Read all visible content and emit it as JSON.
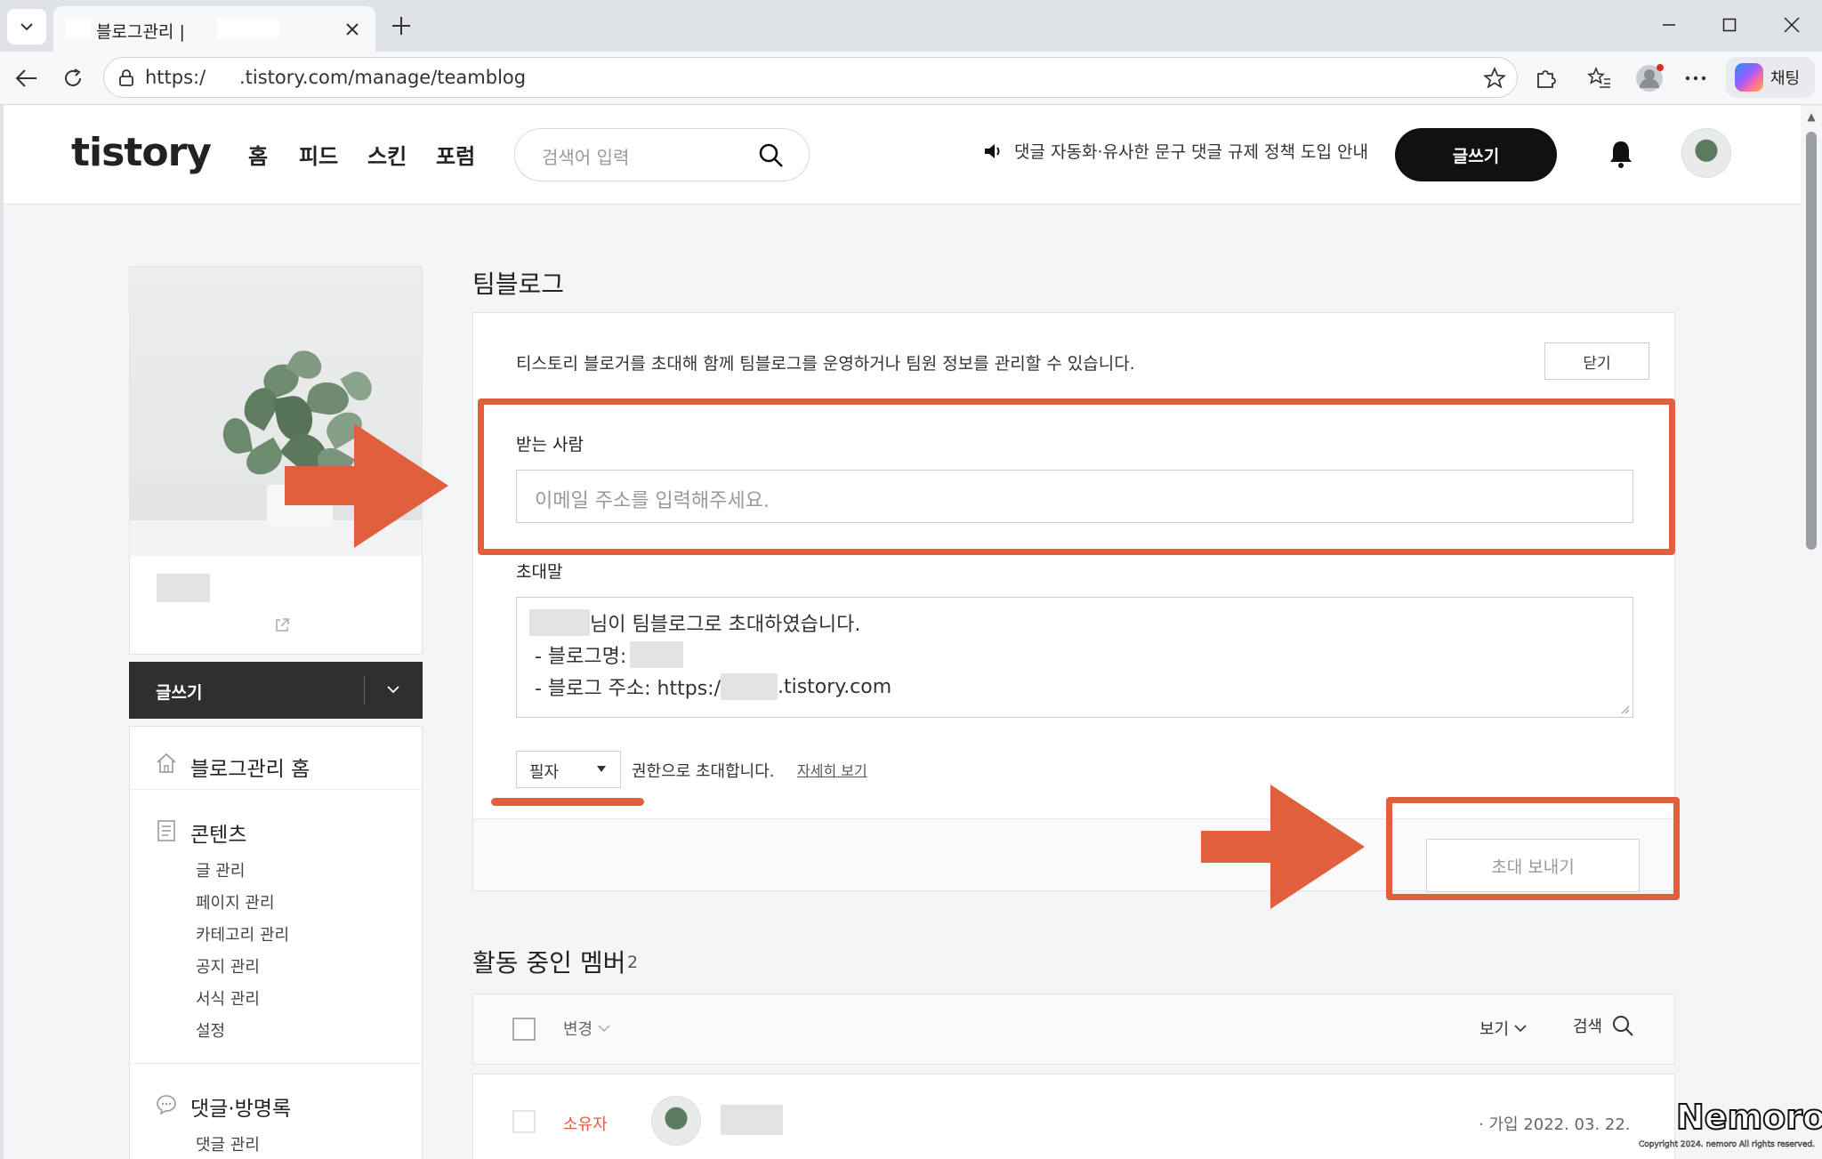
{
  "browser": {
    "tab_title": "블로그관리 |",
    "url_prefix": "https:/",
    "url_rest": ".tistory.com/manage/teamblog",
    "copilot_label": "채팅"
  },
  "header": {
    "logo": "tistory",
    "nav": [
      "홈",
      "피드",
      "스킨",
      "포럼"
    ],
    "search_placeholder": "검색어 입력",
    "notice": "댓글 자동화·유사한 문구 댓글 규제 정책 도입 안내",
    "write_label": "글쓰기"
  },
  "sidebar": {
    "write_label": "글쓰기",
    "home_label": "블로그관리 홈",
    "contents_title": "콘텐츠",
    "contents_items": [
      "글 관리",
      "페이지 관리",
      "카테고리 관리",
      "공지 관리",
      "서식 관리",
      "설정"
    ],
    "comments_title": "댓글·방명록",
    "comments_items": [
      "댓글 관리"
    ]
  },
  "main": {
    "title": "팀블로그",
    "intro": "티스토리 블로거를 초대해 함께 팀블로그를 운영하거나 팀원 정보를 관리할 수 있습니다.",
    "close_label": "닫기",
    "recipient_label": "받는 사람",
    "email_placeholder": "이메일 주소를 입력해주세요.",
    "message_label": "초대말",
    "message_line1": "님이 팀블로그로 초대하였습니다.",
    "message_line2": "- 블로그명:",
    "message_line3_prefix": "- 블로그 주소: https:/",
    "message_line3_suffix": ".tistory.com",
    "role_value": "필자",
    "role_suffix": "권한으로 초대합니다.",
    "details_link": "자세히 보기",
    "send_label": "초대 보내기"
  },
  "members": {
    "title": "활동 중인 멤버",
    "count": "2",
    "change_label": "변경",
    "view_label": "보기",
    "search_label": "검색",
    "rows": [
      {
        "role": "소유자",
        "join_date": "· 가입 2022. 03. 22."
      }
    ]
  },
  "watermark": {
    "brand": "Nemoro",
    "copyright": "Copyright 2024. nemoro All rights reserved."
  },
  "colors": {
    "annotation": "#e0603e",
    "owner_badge": "#e35b3f",
    "primary_button": "#111111"
  }
}
